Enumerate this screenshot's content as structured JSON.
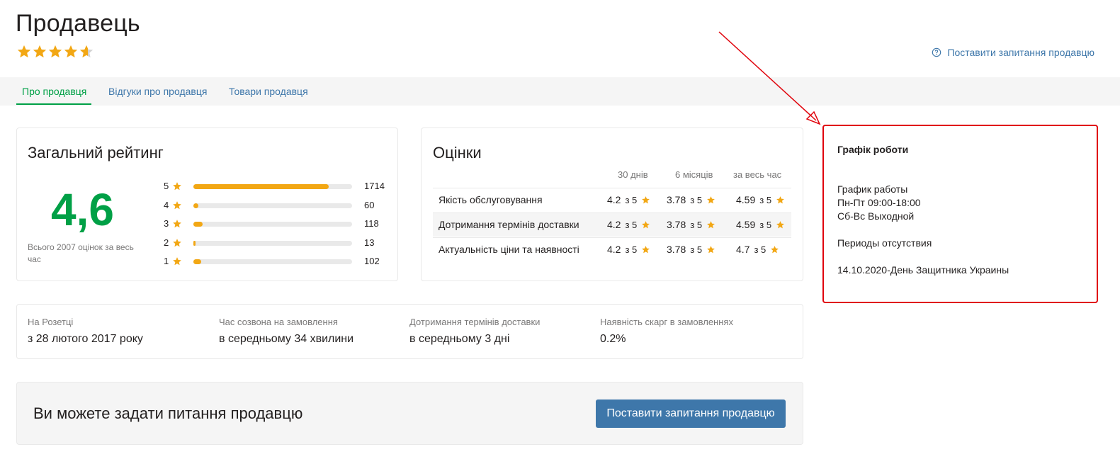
{
  "header": {
    "title": "Продавець",
    "rating_stars": 4.6,
    "ask_link": "Поставити запитання продавцю"
  },
  "tabs": [
    {
      "label": "Про продавця",
      "active": true
    },
    {
      "label": "Відгуки про продавця",
      "active": false
    },
    {
      "label": "Товари продавця",
      "active": false
    }
  ],
  "overall": {
    "title": "Загальний рейтинг",
    "value": "4,6",
    "total_note": "Всього 2007 оцінок за весь час",
    "distribution": [
      {
        "stars": "5",
        "count": "1714",
        "fraction": 0.854
      },
      {
        "stars": "4",
        "count": "60",
        "fraction": 0.03
      },
      {
        "stars": "3",
        "count": "118",
        "fraction": 0.059
      },
      {
        "stars": "2",
        "count": "13",
        "fraction": 0.006
      },
      {
        "stars": "1",
        "count": "102",
        "fraction": 0.051
      }
    ]
  },
  "scores": {
    "title": "Оцінки",
    "columns": [
      "30 днів",
      "6 місяців",
      "за весь час"
    ],
    "rows": [
      {
        "label": "Якість обслуговування",
        "values": [
          [
            "4.2",
            "з 5"
          ],
          [
            "3.78",
            "з 5"
          ],
          [
            "4.59",
            "з 5"
          ]
        ]
      },
      {
        "label": "Дотримання термінів доставки",
        "values": [
          [
            "4.2",
            "з 5"
          ],
          [
            "3.78",
            "з 5"
          ],
          [
            "4.59",
            "з 5"
          ]
        ]
      },
      {
        "label": "Актуальність ціни та наявності",
        "values": [
          [
            "4.2",
            "з 5"
          ],
          [
            "3.78",
            "з 5"
          ],
          [
            "4.7",
            "з 5"
          ]
        ]
      }
    ]
  },
  "info": [
    {
      "label": "На Розетці",
      "value": "з 28 лютого 2017 року"
    },
    {
      "label": "Час созвона на замовлення",
      "value": "в середньому 34 хвилини"
    },
    {
      "label": "Дотримання термінів доставки",
      "value": "в середньому 3 дні"
    },
    {
      "label": "Наявність скарг в замовленнях",
      "value": "0.2%"
    }
  ],
  "question": {
    "text": "Ви можете задати питання продавцю",
    "button": "Поставити запитання продавцю"
  },
  "schedule": {
    "title": "Графік роботи",
    "lines": [
      "График работы",
      "Пн-Пт 09:00-18:00",
      "Сб-Вс Выходной",
      "Периоды отсутствия",
      "14.10.2020-День Защитника Украины"
    ]
  },
  "colors": {
    "accent_green": "#00a046",
    "link_blue": "#3e77aa",
    "star_orange": "#f2a714",
    "annotation_red": "#e0050d"
  }
}
